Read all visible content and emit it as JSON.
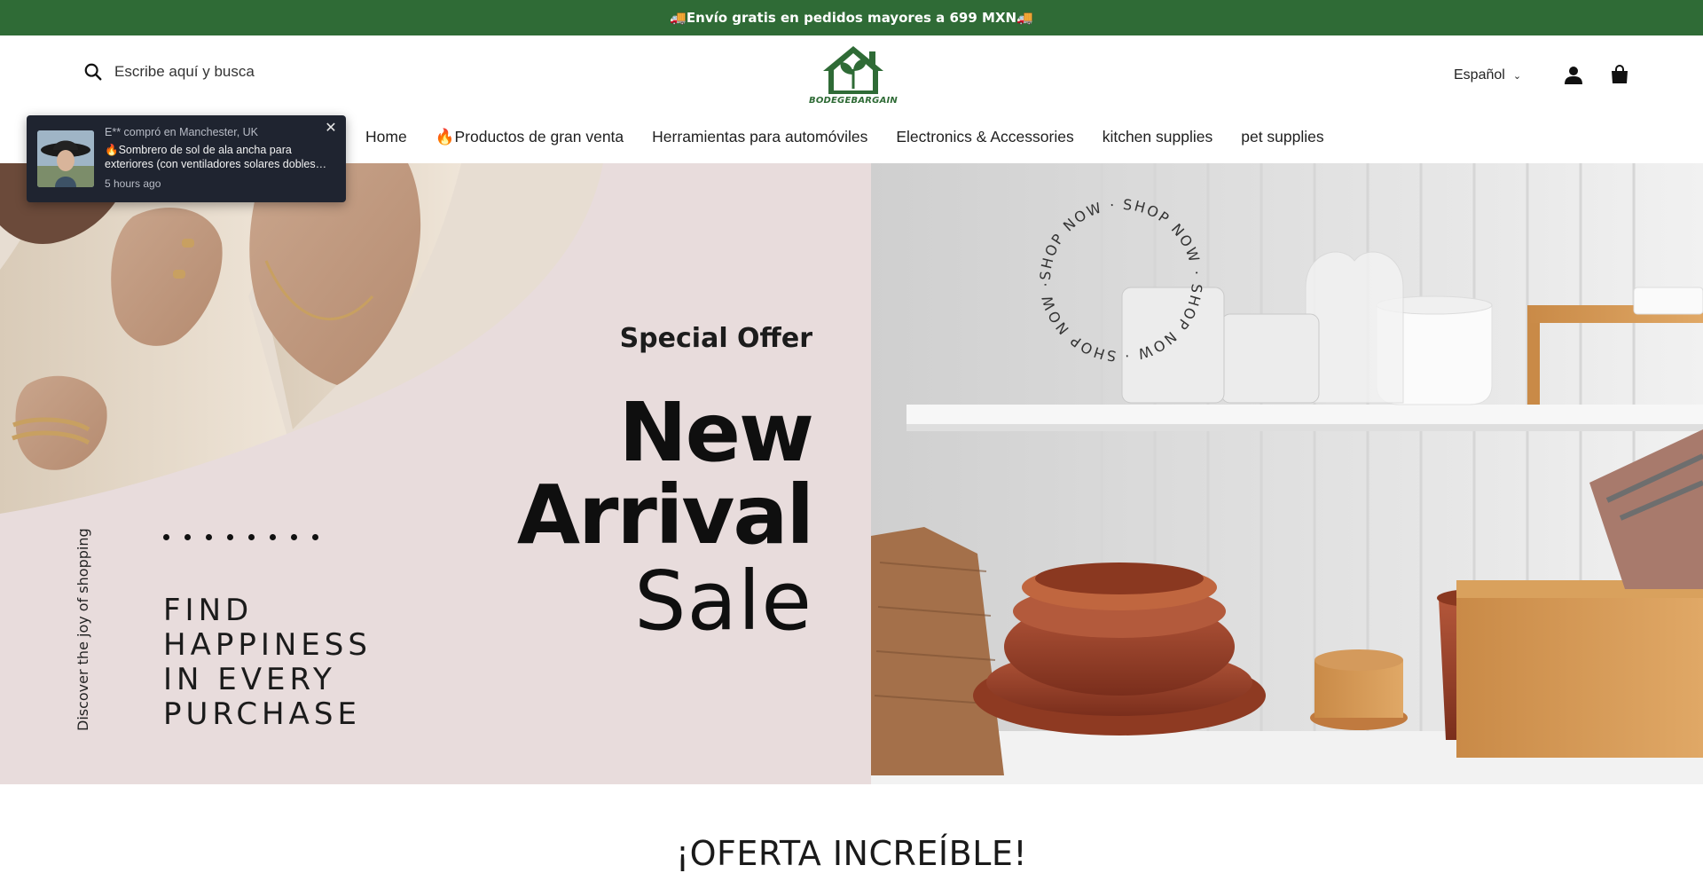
{
  "announcement": {
    "text": "🚚Envío gratis en pedidos mayores a 699 MXN🚚"
  },
  "header": {
    "search": {
      "placeholder": "Escribe aquí y busca"
    },
    "logo": {
      "text": "BODEGEBARGAIN",
      "color": "#2f6b36"
    },
    "language": {
      "selected": "Español"
    },
    "icons": {
      "account": "person-icon",
      "cart": "shopping-bag-icon",
      "search": "search-icon"
    }
  },
  "nav": {
    "items": [
      {
        "label": "Home"
      },
      {
        "label": "🔥Productos de gran venta"
      },
      {
        "label": "Herramientas para automóviles"
      },
      {
        "label": "Electronics & Accessories"
      },
      {
        "label": "kitchen supplies"
      },
      {
        "label": "pet supplies"
      }
    ]
  },
  "notification": {
    "buyer": "E** compró en Manchester, UK",
    "product": "🔥Sombrero de sol de ala ancha para exteriores (con ventiladores solares dobles incorporados)",
    "time": "5 hours ago"
  },
  "hero": {
    "special_offer": "Special Offer",
    "headline_1": "New",
    "headline_2": "Arrival",
    "headline_3": "Sale",
    "find_1": "FIND",
    "find_2": "HAPPINESS",
    "find_3": "IN EVERY",
    "find_4": "PURCHASE",
    "discover": "Discover the joy of shopping",
    "shop_now_ring": "SHOP NOW · SHOP NOW · SHOP NOW · SHOP NOW ·"
  },
  "section": {
    "title": "¡OFERTA INCREÍBLE!"
  },
  "colors": {
    "brand_green": "#2f6b36",
    "popup_bg": "#1f2430"
  }
}
